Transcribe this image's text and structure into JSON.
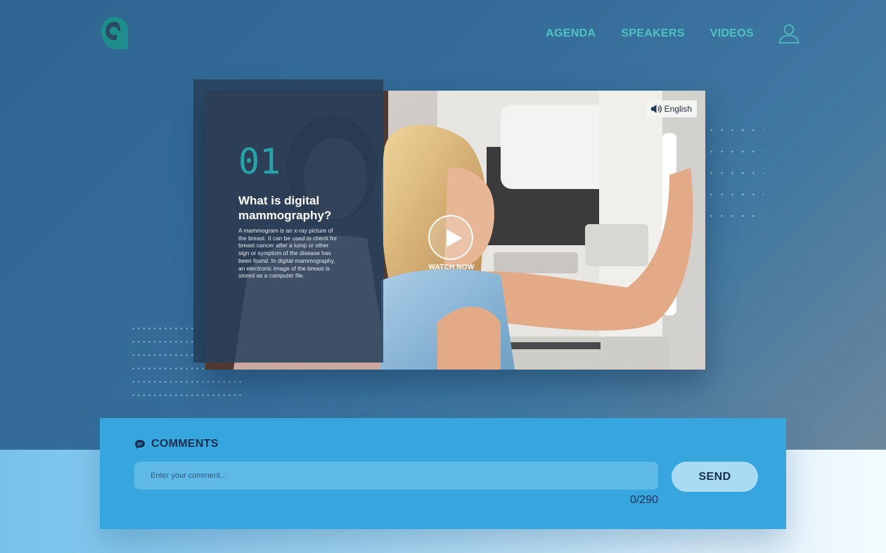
{
  "nav": {
    "items": [
      {
        "label": "AGENDA"
      },
      {
        "label": "SPEAKERS"
      },
      {
        "label": "VIDEOS"
      }
    ],
    "accent": "#4fc3c4"
  },
  "video": {
    "number": "01",
    "title": "What is digital mammography?",
    "description": "A mammogram is an x-ray picture of the breast. It can be used to check for breast cancer after a lump or other sign or symptom of the disease has been found. In digital mammography, an electronic image of the breast is stored as a computer file.",
    "language": "English",
    "watch_label": "WATCH NOW"
  },
  "comments": {
    "heading": "COMMENTS",
    "placeholder": "Enter your comment...",
    "send_label": "SEND",
    "counter": "0/290"
  },
  "icons": {
    "logo": "logo-icon",
    "user": "user-icon",
    "speaker": "speaker-icon",
    "chat": "chat-bubble-icon",
    "play": "play-icon"
  }
}
